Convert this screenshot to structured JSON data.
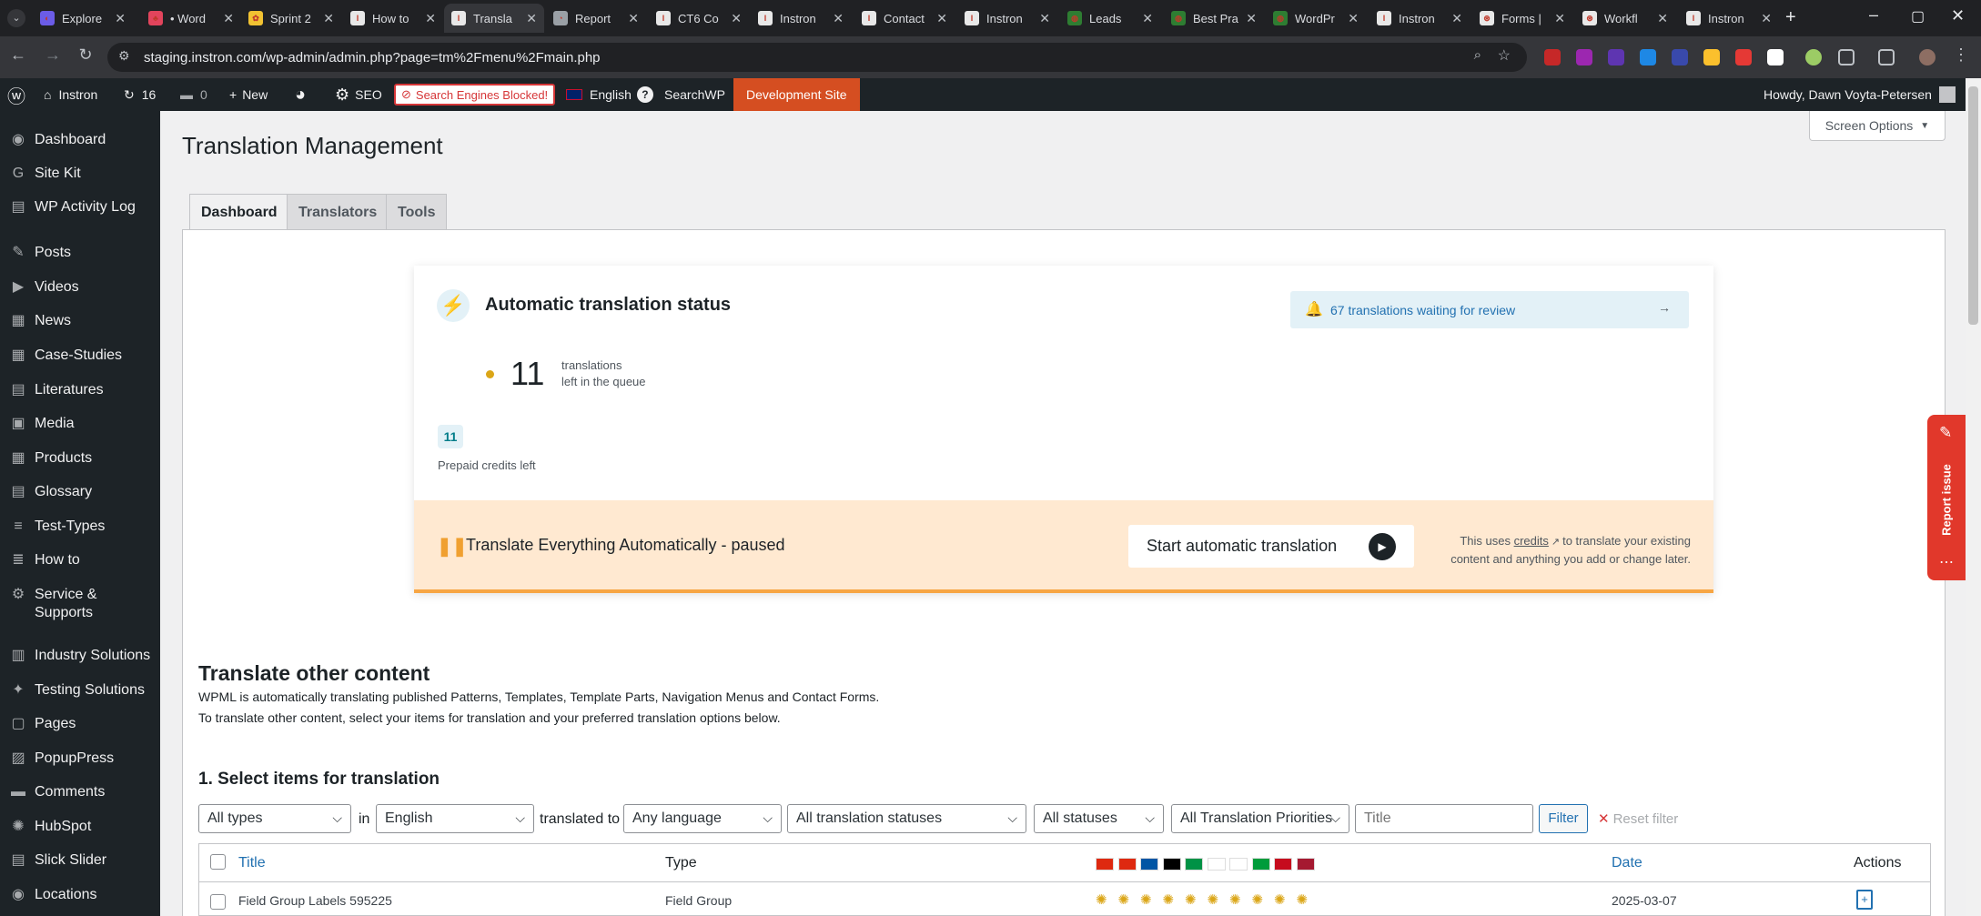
{
  "browser": {
    "tabs": [
      {
        "title": "Explore",
        "fav": "◐",
        "fav_color": "#6b5ce7"
      },
      {
        "title": "• Word",
        "fav": "♣",
        "fav_color": "#e2445c"
      },
      {
        "title": "Sprint 2",
        "fav": "✿",
        "fav_color": "#f1c232"
      },
      {
        "title": "How to",
        "fav": "I",
        "fav_color": "#e8e8e8"
      },
      {
        "title": "Transla",
        "fav": "I",
        "fav_color": "#e8e8e8"
      },
      {
        "title": "Report",
        "fav": "◔",
        "fav_color": "#9aa0a6"
      },
      {
        "title": "CT6 Co",
        "fav": "I",
        "fav_color": "#e8e8e8"
      },
      {
        "title": "Instron",
        "fav": "I",
        "fav_color": "#e8e8e8"
      },
      {
        "title": "Contact",
        "fav": "I",
        "fav_color": "#e8e8e8"
      },
      {
        "title": "Instron",
        "fav": "I",
        "fav_color": "#e8e8e8"
      },
      {
        "title": "Leads",
        "fav": "◍",
        "fav_color": "#2e7d32"
      },
      {
        "title": "Best Pra",
        "fav": "◍",
        "fav_color": "#2e7d32"
      },
      {
        "title": "WordPr",
        "fav": "◍",
        "fav_color": "#2e7d32"
      },
      {
        "title": "Instron",
        "fav": "I",
        "fav_color": "#e8e8e8"
      },
      {
        "title": "Forms |",
        "fav": "⊛",
        "fav_color": "#e8e8e8"
      },
      {
        "title": "Workfl",
        "fav": "⊛",
        "fav_color": "#e8e8e8"
      },
      {
        "title": "Instron",
        "fav": "I",
        "fav_color": "#e8e8e8"
      }
    ],
    "url": "staging.instron.com/wp-admin/admin.php?page=tm%2Fmenu%2Fmain.php"
  },
  "adminbar": {
    "site": "Instron",
    "updates": "16",
    "comments": "0",
    "new": "New",
    "seo": "SEO",
    "search_blocked": "Search Engines Blocked!",
    "language": "English",
    "help": "?",
    "searchwp": "SearchWP",
    "dev_site": "Development Site",
    "howdy": "Howdy, Dawn Voyta-Petersen"
  },
  "sidebar": [
    {
      "label": "Dashboard",
      "icon": "dashboard-icon",
      "glyph": "◉"
    },
    {
      "label": "Site Kit",
      "icon": "sitekit-icon",
      "glyph": "G"
    },
    {
      "label": "WP Activity Log",
      "icon": "activity-log-icon",
      "glyph": "▤"
    },
    {
      "label": "Posts",
      "icon": "pin-icon",
      "glyph": "✎"
    },
    {
      "label": "Videos",
      "icon": "video-icon",
      "glyph": "▶"
    },
    {
      "label": "News",
      "icon": "news-icon",
      "glyph": "▦"
    },
    {
      "label": "Case-Studies",
      "icon": "case-icon",
      "glyph": "▦"
    },
    {
      "label": "Literatures",
      "icon": "book-icon",
      "glyph": "▤"
    },
    {
      "label": "Media",
      "icon": "media-icon",
      "glyph": "▣"
    },
    {
      "label": "Products",
      "icon": "products-icon",
      "glyph": "▦"
    },
    {
      "label": "Glossary",
      "icon": "glossary-icon",
      "glyph": "▤"
    },
    {
      "label": "Test-Types",
      "icon": "test-types-icon",
      "glyph": "≡"
    },
    {
      "label": "How to",
      "icon": "how-to-icon",
      "glyph": "≣"
    },
    {
      "label": "Service &",
      "label2": "Supports",
      "icon": "service-icon",
      "glyph": "⚙"
    },
    {
      "label": "Industry Solutions",
      "icon": "industry-icon",
      "glyph": "▥"
    },
    {
      "label": "Testing Solutions",
      "icon": "bulb-icon",
      "glyph": "✦"
    },
    {
      "label": "Pages",
      "icon": "pages-icon",
      "glyph": "▢"
    },
    {
      "label": "PopupPress",
      "icon": "popup-icon",
      "glyph": "▨"
    },
    {
      "label": "Comments",
      "icon": "comments-icon",
      "glyph": "▬"
    },
    {
      "label": "HubSpot",
      "icon": "hubspot-icon",
      "glyph": "✺"
    },
    {
      "label": "Slick Slider",
      "icon": "slider-icon",
      "glyph": "▤"
    },
    {
      "label": "Locations",
      "icon": "location-icon",
      "glyph": "◉"
    }
  ],
  "screen_options": "Screen Options",
  "page_title": "Translation Management",
  "tabs": [
    "Dashboard",
    "Translators",
    "Tools"
  ],
  "auto": {
    "title": "Automatic translation status",
    "review": "67 translations waiting for review",
    "count": "11",
    "count_l1": "translations",
    "count_l2": "left in the queue",
    "credits": "11",
    "credits_label": "Prepaid credits left",
    "paused": "Translate Everything Automatically - paused",
    "start": "Start automatic translation",
    "note_a": "This uses",
    "note_link": "credits",
    "note_b": "to translate your existing",
    "note_c": "content and anything you add or change later."
  },
  "other": {
    "heading": "Translate other content",
    "desc1": "WPML is automatically translating published Patterns, Templates, Template Parts, Navigation Menus and Contact Forms.",
    "desc2": "To translate other content, select your items for translation and your preferred translation options below.",
    "step": "1. Select items for translation",
    "filters": {
      "types": "All types",
      "in": "in",
      "lang": "English",
      "translated_to": "translated to",
      "any": "Any language",
      "statuses_tr": "All translation statuses",
      "statuses": "All statuses",
      "priorities": "All Translation Priorities",
      "title_ph": "Title",
      "filter": "Filter",
      "reset": "Reset filter"
    },
    "table": {
      "cols": [
        "Title",
        "Type",
        "Date",
        "Actions"
      ],
      "row": {
        "title": "Field Group Labels 595225",
        "type": "Field Group",
        "date": "2025-03-07"
      }
    }
  },
  "report_issue": "Report issue",
  "flags": [
    "#de2910",
    "#de2910",
    "#0055a4",
    "#000000",
    "#009246",
    "#ffffff",
    "#ffffff",
    "#009c3b",
    "#c60b1e",
    "#a51931"
  ]
}
